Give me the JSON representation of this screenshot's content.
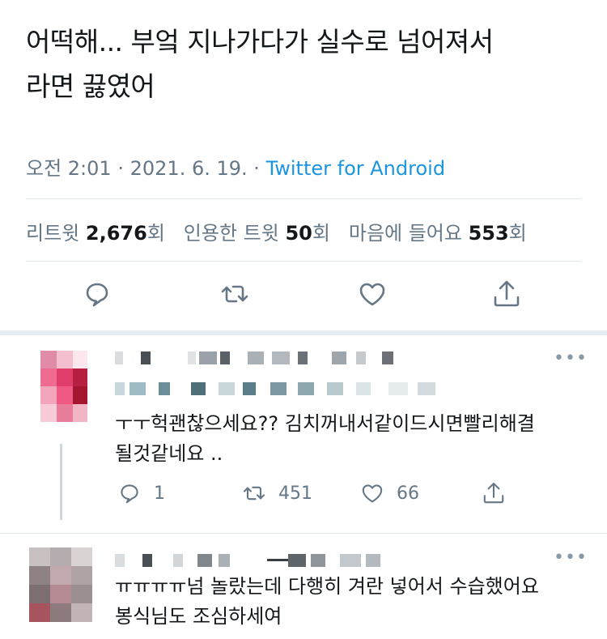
{
  "tweet": {
    "text_line1": "어떡해... 부엌 지나가다가 실수로 넘어져서",
    "text_line2": "라면 끓였어",
    "time": "오전 2:01",
    "date": "2021. 6. 19.",
    "source": "Twitter for Android",
    "sep": "·"
  },
  "stats": {
    "retweets_label": "리트윗",
    "retweets_count": "2,676",
    "retweets_unit": "회",
    "quotes_label": "인용한 트윗",
    "quotes_count": "50",
    "quotes_unit": "회",
    "likes_label": "마음에 들어요",
    "likes_count": "553",
    "likes_unit": "회"
  },
  "actions": {
    "icons": [
      "reply-icon",
      "retweet-icon",
      "like-icon",
      "share-icon"
    ]
  },
  "replies": [
    {
      "text_line1": "ㅜㅜ헉괜찮으세요?? 김치꺼내서같이드시면빨리해결",
      "text_line2": "될것같네요 ..",
      "reply_count": "1",
      "retweet_count": "451",
      "like_count": "66",
      "more": "•••"
    },
    {
      "text_line1": "ㅠㅠㅠㅠ넘 놀랐는데 다행히 겨란 넣어서 수습했어요",
      "text_line2": "봉식님도 조심하세여",
      "more": "•••"
    }
  ],
  "colors": {
    "text": "#14171a",
    "secondary": "#657786",
    "link": "#1b95e0",
    "divider": "#e1e8ed"
  }
}
